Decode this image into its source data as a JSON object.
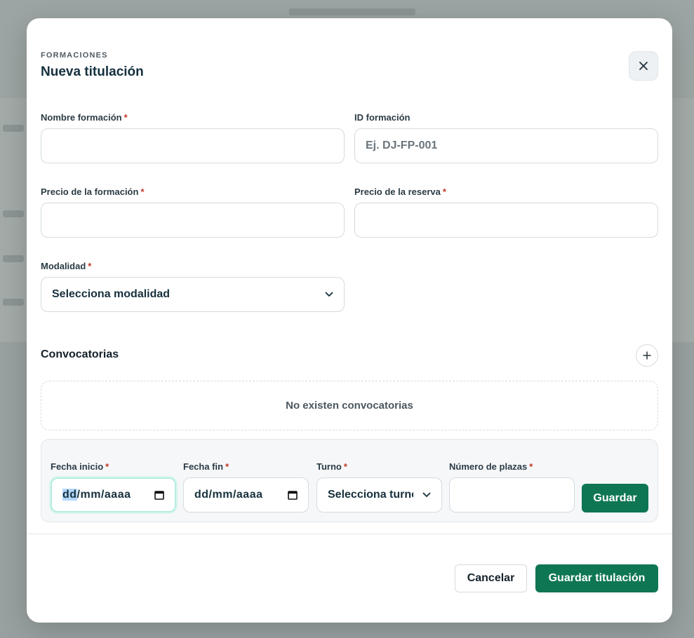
{
  "background": {
    "partial_text": "Nueva titulación"
  },
  "modal": {
    "eyebrow": "FORMACIONES",
    "title": "Nueva titulación"
  },
  "fields": {
    "nombre": {
      "label": "Nombre formación",
      "required": "*",
      "value": "",
      "placeholder": ""
    },
    "id": {
      "label": "ID formación",
      "value": "",
      "placeholder": "Ej. DJ-FP-001"
    },
    "precio_formacion": {
      "label": "Precio de la formación",
      "required": "*",
      "value": "",
      "placeholder": ""
    },
    "precio_reserva": {
      "label": "Precio de la reserva",
      "required": "*",
      "value": "",
      "placeholder": ""
    },
    "modalidad": {
      "label": "Modalidad",
      "required": "*",
      "selected": "Selecciona modalidad"
    }
  },
  "convocatorias": {
    "title": "Convocatorias",
    "empty_text": "No existen convocatorias",
    "form": {
      "fecha_inicio": {
        "label": "Fecha inicio",
        "required": "*",
        "day": "dd",
        "rest": "/mm/aaaa"
      },
      "fecha_fin": {
        "label": "Fecha fin",
        "required": "*",
        "value": "dd/mm/aaaa"
      },
      "turno": {
        "label": "Turno",
        "required": "*",
        "selected": "Selecciona turno"
      },
      "plazas": {
        "label": "Número de plazas",
        "required": "*",
        "value": ""
      },
      "save_label": "Guardar"
    }
  },
  "footer": {
    "cancel_label": "Cancelar",
    "submit_label": "Guardar titulación"
  },
  "colors": {
    "primary": "#0f7653",
    "required": "#c0392b",
    "overlay": "#98a1a0"
  },
  "icons": [
    "close-icon",
    "chevron-down-icon",
    "plus-icon",
    "calendar-icon"
  ]
}
